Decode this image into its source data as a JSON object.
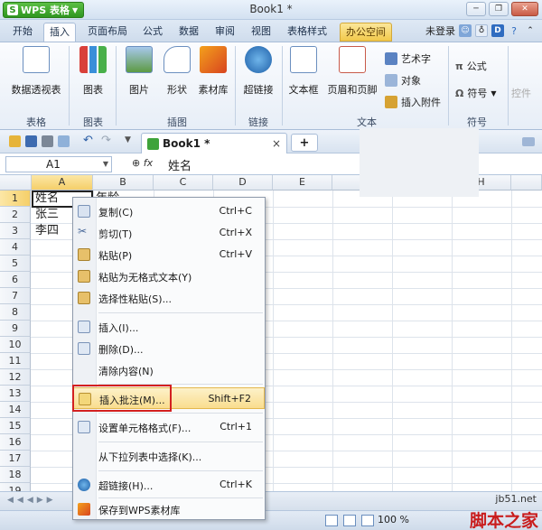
{
  "titlebar": {
    "app_name": "WPS 表格",
    "logo": "S",
    "doc_title": "Book1 *"
  },
  "tabs": [
    "开始",
    "插入",
    "页面布局",
    "公式",
    "数据",
    "审阅",
    "视图",
    "表格样式",
    "办公空间"
  ],
  "active_tab": "插入",
  "menu_right": {
    "login": "未登录"
  },
  "ribbon": {
    "buttons": [
      "数据透视表",
      "图表",
      "图片",
      "形状",
      "素材库",
      "超链接",
      "文本框",
      "页眉和页脚"
    ],
    "small": {
      "art": "艺术字",
      "object": "对象",
      "attach": "插入附件",
      "formula": "公式",
      "symbol": "符号",
      "control": "控件"
    },
    "groups": [
      "表格",
      "图表",
      "插图",
      "链接",
      "文本",
      "符号"
    ]
  },
  "doc_tab": {
    "name": "Book1 *",
    "close": "×",
    "new": "+"
  },
  "formula_bar": {
    "cell_ref": "A1",
    "fx": "fx",
    "value": "姓名"
  },
  "grid": {
    "columns": [
      "A",
      "B",
      "C",
      "D",
      "E",
      "H"
    ],
    "rows": [
      "1",
      "2",
      "3",
      "4",
      "5",
      "6",
      "7",
      "8",
      "9",
      "10",
      "11",
      "12",
      "13",
      "14",
      "15",
      "16",
      "17",
      "18",
      "19"
    ],
    "cells": {
      "a1": "姓名",
      "b1": "年龄",
      "a2": "张三",
      "a3": "李四"
    }
  },
  "context_menu": [
    {
      "label": "复制(C)",
      "key": "Ctrl+C"
    },
    {
      "label": "剪切(T)",
      "key": "Ctrl+X"
    },
    {
      "label": "粘贴(P)",
      "key": "Ctrl+V"
    },
    {
      "label": "粘贴为无格式文本(Y)",
      "key": ""
    },
    {
      "label": "选择性粘贴(S)...",
      "key": ""
    },
    {
      "label": "插入(I)...",
      "key": ""
    },
    {
      "label": "删除(D)...",
      "key": ""
    },
    {
      "label": "清除内容(N)",
      "key": ""
    },
    {
      "label": "插入批注(M)...",
      "key": "Shift+F2"
    },
    {
      "label": "设置单元格格式(F)...",
      "key": "Ctrl+1"
    },
    {
      "label": "从下拉列表中选择(K)...",
      "key": ""
    },
    {
      "label": "超链接(H)...",
      "key": "Ctrl+K"
    },
    {
      "label": "保存到WPS素材库",
      "key": ""
    }
  ],
  "status": {
    "zoom": "100 %"
  },
  "watermark": {
    "url": "jb51.net",
    "text": "脚本之家"
  }
}
